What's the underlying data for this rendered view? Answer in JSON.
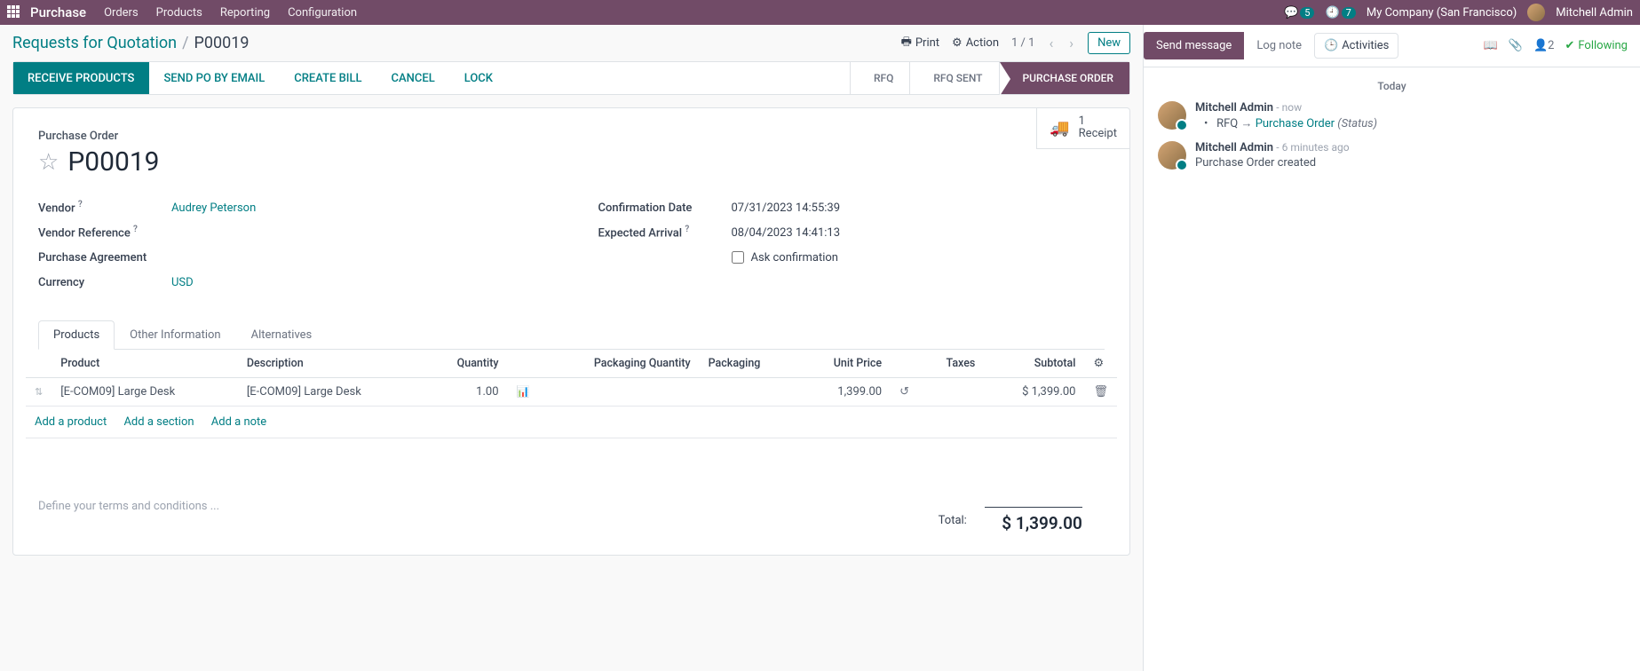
{
  "nav": {
    "brand": "Purchase",
    "menu": [
      "Orders",
      "Products",
      "Reporting",
      "Configuration"
    ],
    "chat_badge": "5",
    "clock_badge": "7",
    "company": "My Company (San Francisco)",
    "user": "Mitchell Admin"
  },
  "breadcrumb": {
    "root": "Requests for Quotation",
    "current": "P00019",
    "print": "Print",
    "action": "Action",
    "pager": "1 / 1",
    "new_btn": "New"
  },
  "statusbar": {
    "buttons": [
      {
        "label": "RECEIVE PRODUCTS",
        "primary": true
      },
      {
        "label": "SEND PO BY EMAIL",
        "primary": false
      },
      {
        "label": "CREATE BILL",
        "primary": false
      },
      {
        "label": "CANCEL",
        "primary": false
      },
      {
        "label": "LOCK",
        "primary": false
      }
    ],
    "stages": [
      {
        "label": "RFQ",
        "active": false
      },
      {
        "label": "RFQ SENT",
        "active": false
      },
      {
        "label": "PURCHASE ORDER",
        "active": true
      }
    ]
  },
  "button_box": {
    "count": "1",
    "label": "Receipt"
  },
  "record": {
    "title_label": "Purchase Order",
    "name": "P00019",
    "fields_left": {
      "vendor_label": "Vendor",
      "vendor_value": "Audrey Peterson",
      "vendor_ref_label": "Vendor Reference",
      "vendor_ref_value": "",
      "agreement_label": "Purchase Agreement",
      "agreement_value": "",
      "currency_label": "Currency",
      "currency_value": "USD"
    },
    "fields_right": {
      "confirm_label": "Confirmation Date",
      "confirm_value": "07/31/2023 14:55:39",
      "expected_label": "Expected Arrival",
      "expected_value": "08/04/2023 14:41:13",
      "ask_confirm_label": "Ask confirmation"
    }
  },
  "tabs": [
    "Products",
    "Other Information",
    "Alternatives"
  ],
  "table": {
    "headers": {
      "product": "Product",
      "description": "Description",
      "quantity": "Quantity",
      "pkg_qty": "Packaging Quantity",
      "packaging": "Packaging",
      "unit_price": "Unit Price",
      "taxes": "Taxes",
      "subtotal": "Subtotal"
    },
    "rows": [
      {
        "product": "[E-COM09] Large Desk",
        "description": "[E-COM09] Large Desk",
        "quantity": "1.00",
        "pkg_qty": "",
        "packaging": "",
        "unit_price": "1,399.00",
        "taxes": "",
        "subtotal": "$ 1,399.00"
      }
    ],
    "add_links": {
      "product": "Add a product",
      "section": "Add a section",
      "note": "Add a note"
    }
  },
  "terms_placeholder": "Define your terms and conditions ...",
  "totals": {
    "total_label": "Total:",
    "total_value": "$ 1,399.00"
  },
  "chatter": {
    "send": "Send message",
    "log": "Log note",
    "activities": "Activities",
    "follower_count": "2",
    "following": "Following",
    "today": "Today",
    "messages": [
      {
        "author": "Mitchell Admin",
        "time": "now",
        "tracking": {
          "field": "RFQ",
          "to": "Purchase Order",
          "status": "(Status)"
        }
      },
      {
        "author": "Mitchell Admin",
        "time": "6 minutes ago",
        "body": "Purchase Order created"
      }
    ]
  }
}
